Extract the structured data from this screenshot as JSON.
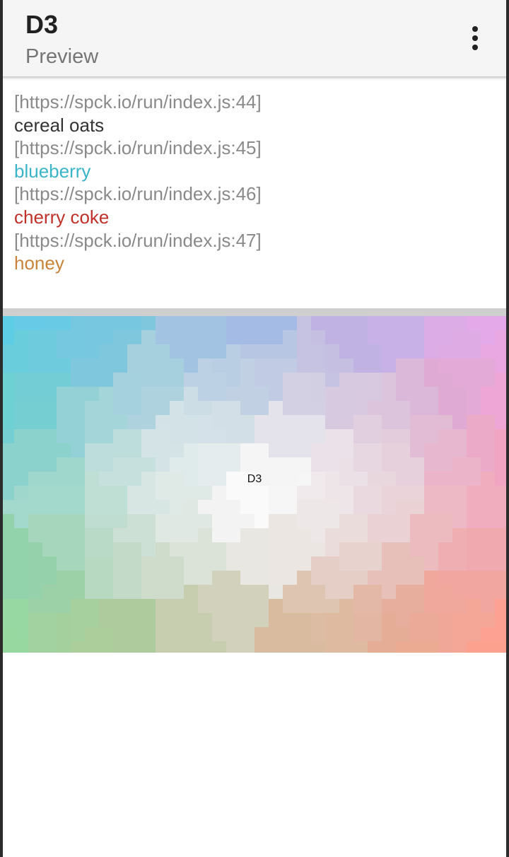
{
  "appbar": {
    "title": "D3",
    "subtitle": "Preview",
    "menu_icon": "more-vertical-icon"
  },
  "console": {
    "entries": [
      {
        "source": "[https://spck.io/run/index.js:44]",
        "message": "cereal oats",
        "color": "#333333"
      },
      {
        "source": "[https://spck.io/run/index.js:45]",
        "message": "blueberry",
        "color": "#3cb4c8"
      },
      {
        "source": "[https://spck.io/run/index.js:46]",
        "message": "cherry coke",
        "color": "#c0312b"
      },
      {
        "source": "[https://spck.io/run/index.js:47]",
        "message": "honey",
        "color": "#c8843a"
      }
    ]
  },
  "preview": {
    "label": "D3",
    "corner_colors": {
      "top_left": "#5ccde6",
      "top_right": "#e9a8ea",
      "bottom_left": "#9bd99a",
      "bottom_right": "#ffa08e",
      "center": "#ffffff"
    }
  }
}
